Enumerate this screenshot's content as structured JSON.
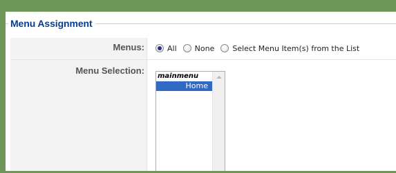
{
  "fieldset": {
    "legend": "Menu Assignment"
  },
  "menus": {
    "label": "Menus:",
    "options": [
      {
        "label": "All",
        "checked": true
      },
      {
        "label": "None",
        "checked": false
      },
      {
        "label": "Select Menu Item(s) from the List",
        "checked": false
      }
    ]
  },
  "menu_selection": {
    "label": "Menu Selection:",
    "group": "mainmenu",
    "items": [
      {
        "label": "Home",
        "selected": true
      }
    ]
  },
  "colors": {
    "frame": "#6e9759",
    "legend": "#0b3c8c",
    "selected_item": "#316ac5"
  }
}
